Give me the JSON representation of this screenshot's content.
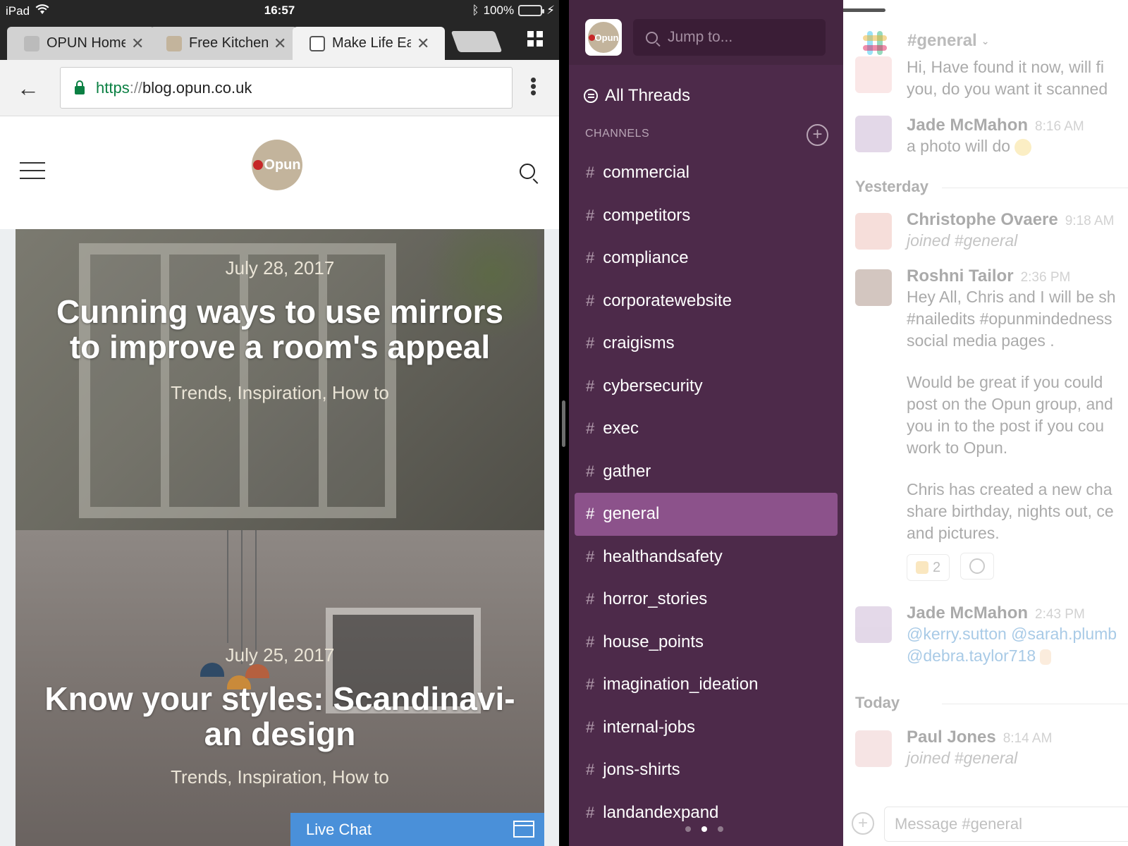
{
  "status_bar": {
    "device": "iPad",
    "time": "16:57",
    "battery": "100%"
  },
  "browser": {
    "tabs": [
      {
        "title": "OPUN Home",
        "active": false
      },
      {
        "title": "Free Kitchen",
        "active": false
      },
      {
        "title": "Make Life Ea",
        "active": true
      }
    ],
    "url": {
      "scheme": "https",
      "sep": "://",
      "host": "blog.opun.co.uk"
    }
  },
  "site": {
    "logo_text": "Opun",
    "posts": [
      {
        "date": "July 28, 2017",
        "title_line1": "Cunning ways to use mirrors",
        "title_line2": "to improve a room's appeal",
        "categories": "Trends, Inspiration, How to"
      },
      {
        "date": "July 25, 2017",
        "title_line1": "Know your styles: Scandinavi-",
        "title_line2": "an design",
        "categories": "Trends, Inspiration, How to"
      }
    ],
    "live_chat": "Live Chat"
  },
  "slack": {
    "jump_placeholder": "Jump to...",
    "all_threads": "All Threads",
    "channels_label": "CHANNELS",
    "channels": [
      "commercial",
      "competitors",
      "compliance",
      "corporatewebsite",
      "craigisms",
      "cybersecurity",
      "exec",
      "gather",
      "general",
      "healthandsafety",
      "horror_stories",
      "house_points",
      "imagination_ideation",
      "internal-jobs",
      "jons-shirts",
      "landandexpand"
    ],
    "selected_channel": "general",
    "channel_title": "#general",
    "messages": {
      "m0": {
        "line1": "Hi, Have found it now, will fi",
        "line2": "you, do you want it scanned"
      },
      "m1": {
        "author": "Jade McMahon",
        "time": "8:16 AM",
        "text": "a photo will do"
      },
      "day1": "Yesterday",
      "m2": {
        "author": "Christophe Ovaere",
        "time": "9:18 AM",
        "text": "joined #general"
      },
      "m3": {
        "author": "Roshni Tailor",
        "time": "2:36 PM",
        "p1": [
          "Hey All, Chris and I will be sh",
          "#nailedits #opunmindedness",
          "social media pages ."
        ],
        "p2": [
          "Would be great if you could",
          "post on the Opun group, and",
          "you in to the post if you cou",
          "work to Opun."
        ],
        "p3": [
          "Chris has created a new cha",
          "share birthday, nights out, ce",
          "and pictures."
        ],
        "reaction_count": "2"
      },
      "m4": {
        "author": "Jade McMahon",
        "time": "2:43 PM",
        "line1": "@kerry.sutton @sarah.plumb",
        "line2": "@debra.taylor718"
      },
      "day2": "Today",
      "m5": {
        "author": "Paul Jones",
        "time": "8:14 AM",
        "text": "joined #general"
      }
    },
    "composer_placeholder": "Message #general"
  },
  "colors": {
    "slack_sidebar": "#4d2a4a",
    "slack_selected": "#8c528b",
    "live_chat": "#4a90d9",
    "ssl_green": "#0b8043",
    "logo_beige": "#c3b49c"
  },
  "icons": {
    "wifi": "wifi-icon",
    "bluetooth": "bluetooth-icon",
    "lock": "lock-icon",
    "back": "back-arrow-icon",
    "menu": "hamburger-icon",
    "search": "search-icon",
    "threads": "threads-icon",
    "add": "plus-circle-icon"
  }
}
